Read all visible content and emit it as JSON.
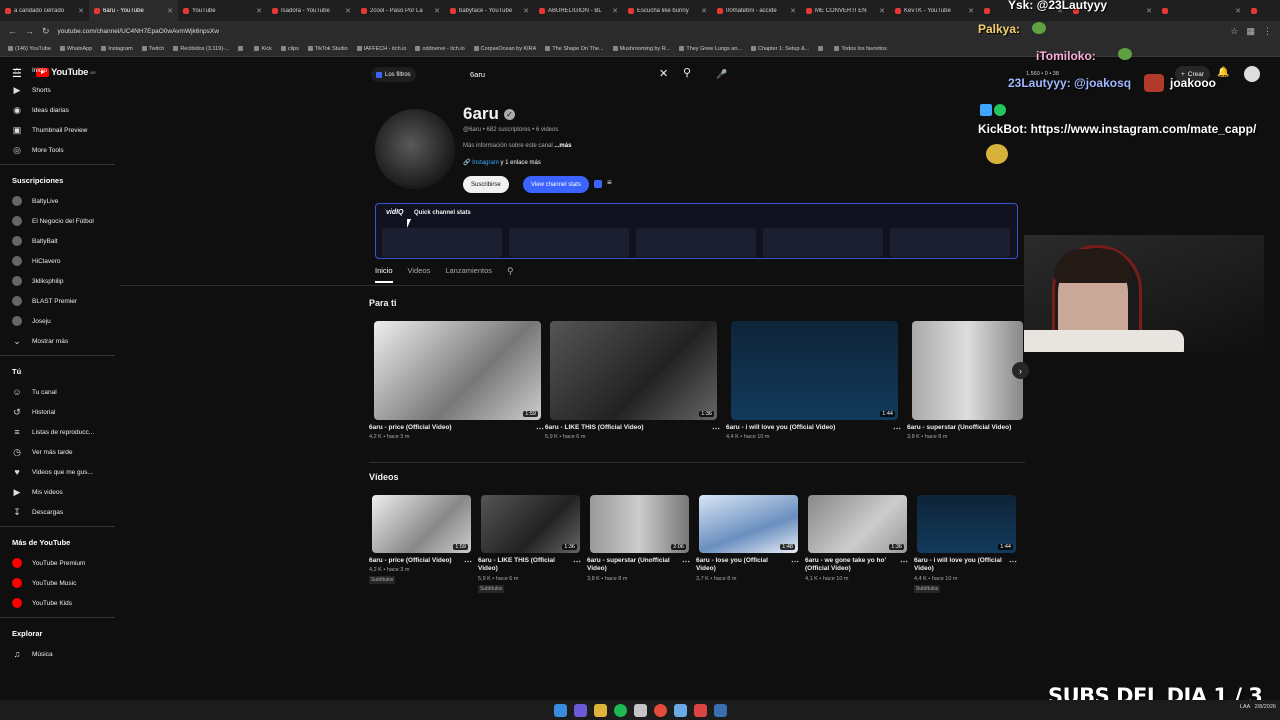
{
  "tabs": [
    "a candado cerrado",
    "6aru - YouTube",
    "YouTube",
    "Isadora - YouTube",
    "2cool - Paso Por La",
    "babyface - YouTube",
    "ABURELIGION - BL",
    "Escucha like bunny",
    "00matebrii - accide",
    "ME CONVERTI EN",
    "KevTK - YouTube",
    "",
    "",
    "",
    ""
  ],
  "address_url": "youtube.com/channel/UC4NH7EpaO0wAvmWjk6npsXw",
  "bookmarks": [
    "(146) YouTube",
    "WhatsApp",
    "Instagram",
    "Twitch",
    "Recibidos (3.119)-...",
    "",
    "Kick",
    "clips",
    "TikTok Studio",
    "IAFFECH - itch.io",
    "oddnerve - itch.io",
    "CorpseOcean by KIRA",
    "The Shape On The...",
    "Mushrooming by R...",
    "They Grew Lungs an...",
    "Chapter 1: Setup &...",
    "",
    "Todos los favoritos"
  ],
  "yt": {
    "logo": "YouTube",
    "region": "AR",
    "filters": "Los filtros",
    "search_value": "6aru",
    "create": "Crear"
  },
  "sidebar": {
    "main": [
      {
        "label": "Inicio",
        "icon": "home-icon"
      },
      {
        "label": "Shorts",
        "icon": "shorts-icon"
      },
      {
        "label": "Ideas diarias",
        "icon": "ideas-icon"
      },
      {
        "label": "Thumbnail Preview",
        "icon": "preview-icon"
      },
      {
        "label": "More Tools",
        "icon": "tools-icon"
      }
    ],
    "subs_title": "Suscripciones",
    "subs": [
      "BaltyLive",
      "El Negocio del Fútbol",
      "BaltyBalt",
      "HiClavero",
      "3kliksphilip",
      "BLAST Premier",
      "Joseju",
      "Mostrar más"
    ],
    "you_title": "Tú",
    "you": [
      "Tu canal",
      "Historial",
      "Listas de reproducc...",
      "Ver más tarde",
      "Videos que me gus...",
      "Mis videos",
      "Descargas"
    ],
    "more_title": "Más de YouTube",
    "more": [
      "YouTube Premium",
      "YouTube Music",
      "YouTube Kids"
    ],
    "explore_title": "Explorar",
    "explore": [
      "Música"
    ]
  },
  "channel": {
    "name": "6aru",
    "meta": "@6aru • 682 suscriptores • 6 videos",
    "about": "Más información sobre este canal",
    "about_more": "...más",
    "links": "Instagram",
    "links_more": "y 1 enlace más",
    "subscribe": "Suscribirse",
    "stats": "View channel stats"
  },
  "vidiq": {
    "logo": "vidIQ",
    "title": "Quick channel stats"
  },
  "channel_tabs": [
    "Inicio",
    "Videos",
    "Lanzamientos"
  ],
  "para_ti": {
    "title": "Para ti",
    "items": [
      {
        "title": "6aru - price (Official Video)",
        "meta": "4,2 K • hace 3 m",
        "dur": "1:59"
      },
      {
        "title": "6aru - LIKE THIS (Official Video)",
        "meta": "5,9 K • hace 6 m",
        "dur": "1:36"
      },
      {
        "title": "6aru - i will love you (Official Video)",
        "meta": "4,4 K • hace 10 m",
        "dur": "1:44"
      },
      {
        "title": "6aru - superstar (Unofficial Video)",
        "meta": "3,8 K • hace 8 m",
        "dur": ""
      }
    ]
  },
  "videos": {
    "title": "Vídeos",
    "items": [
      {
        "title": "6aru - price (Official Video)",
        "meta": "4,2 K • hace 3 m",
        "dur": "1:59",
        "badge": "Subtítulos"
      },
      {
        "title": "6aru - LIKE THIS (Official Video)",
        "meta": "5,9 K • hace 6 m",
        "dur": "1:36",
        "badge": "Subtítulos"
      },
      {
        "title": "6aru - superstar (Unofficial Video)",
        "meta": "3,8 K • hace 8 m",
        "dur": "2:06",
        "badge": ""
      },
      {
        "title": "6aru - lose you (Official Video)",
        "meta": "3,7 K • hace 8 m",
        "dur": "1:48",
        "badge": ""
      },
      {
        "title": "6aru - we gone take yo ho' (Official Video)",
        "meta": "4,1 K • hace 10 m",
        "dur": "1:36",
        "badge": ""
      },
      {
        "title": "6aru - i will love you (Official Video)",
        "meta": "4,4 K • hace 10 m",
        "dur": "1:44",
        "badge": "Subtítulos"
      }
    ]
  },
  "overlay": {
    "chat": [
      "Ysk: @23Lautyyy",
      "Palkya:",
      "iTomiloko:",
      "23Lautyyy: @joakosq",
      "joakooo",
      "KickBot: https://www.instagram.com/mate_capp/"
    ],
    "views": "1.560 • 0 • 38",
    "banner": "SUBS DEL DIA 1 / 3"
  },
  "clock": {
    "lang": "LAA",
    "time": "",
    "date": "2/8/2026"
  }
}
